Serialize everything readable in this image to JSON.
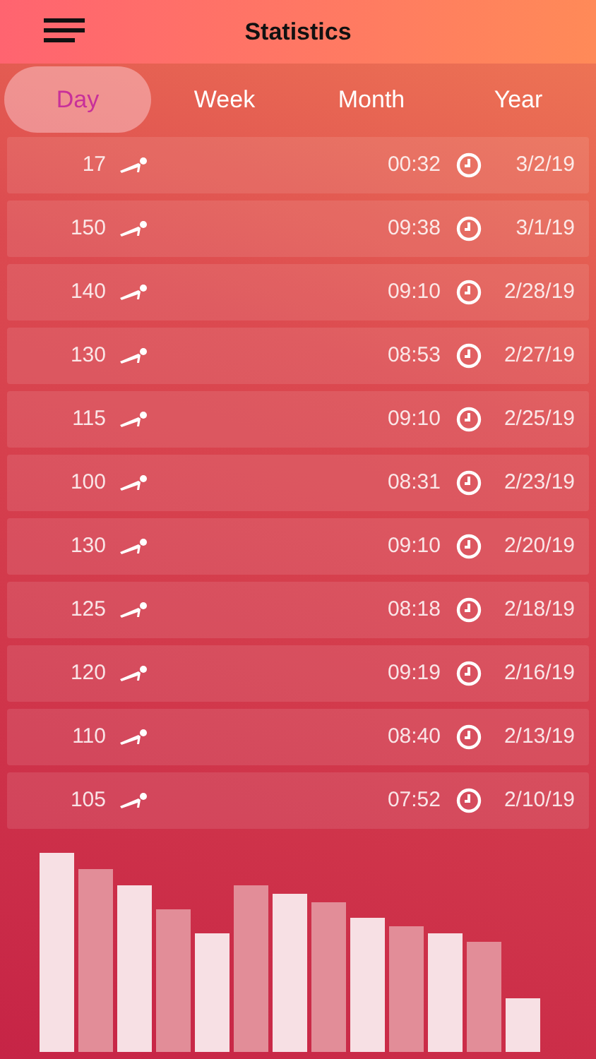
{
  "header": {
    "title": "Statistics"
  },
  "tabs": [
    {
      "label": "Day",
      "selected": true
    },
    {
      "label": "Week",
      "selected": false
    },
    {
      "label": "Month",
      "selected": false
    },
    {
      "label": "Year",
      "selected": false
    }
  ],
  "rows": [
    {
      "count": "17",
      "time": "00:32",
      "date": "3/2/19"
    },
    {
      "count": "150",
      "time": "09:38",
      "date": "3/1/19"
    },
    {
      "count": "140",
      "time": "09:10",
      "date": "2/28/19"
    },
    {
      "count": "130",
      "time": "08:53",
      "date": "2/27/19"
    },
    {
      "count": "115",
      "time": "09:10",
      "date": "2/25/19"
    },
    {
      "count": "100",
      "time": "08:31",
      "date": "2/23/19"
    },
    {
      "count": "130",
      "time": "09:10",
      "date": "2/20/19"
    },
    {
      "count": "125",
      "time": "08:18",
      "date": "2/18/19"
    },
    {
      "count": "120",
      "time": "09:19",
      "date": "2/16/19"
    },
    {
      "count": "110",
      "time": "08:40",
      "date": "2/13/19"
    },
    {
      "count": "105",
      "time": "07:52",
      "date": "2/10/19"
    }
  ]
}
